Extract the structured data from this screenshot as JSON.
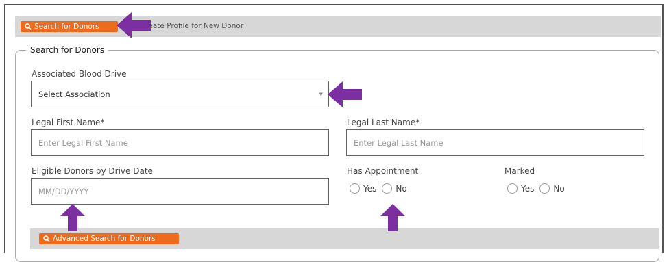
{
  "toolbar": {
    "search_tab_label": "Search for Donors",
    "create_tab_label": "Create Profile for New Donor"
  },
  "form": {
    "legend": "Search for Donors",
    "blood_drive": {
      "label": "Associated Blood Drive",
      "value": "Select Association"
    },
    "first_name": {
      "label": "Legal First Name*",
      "placeholder": "Enter Legal First Name"
    },
    "last_name": {
      "label": "Legal Last Name*",
      "placeholder": "Enter Legal Last Name"
    },
    "drive_date": {
      "label": "Eligible Donors by Drive Date",
      "placeholder": "MM/DD/YYYY"
    },
    "has_appointment": {
      "label": "Has Appointment",
      "options": [
        "Yes",
        "No"
      ]
    },
    "marked": {
      "label": "Marked",
      "options": [
        "Yes",
        "No"
      ]
    },
    "advanced_search_label": "Advanced Search for Donors"
  },
  "colors": {
    "accent": "#ee6a1c",
    "annotation_arrow": "#7b2fa0",
    "bar_gray": "#d7d7d7"
  }
}
